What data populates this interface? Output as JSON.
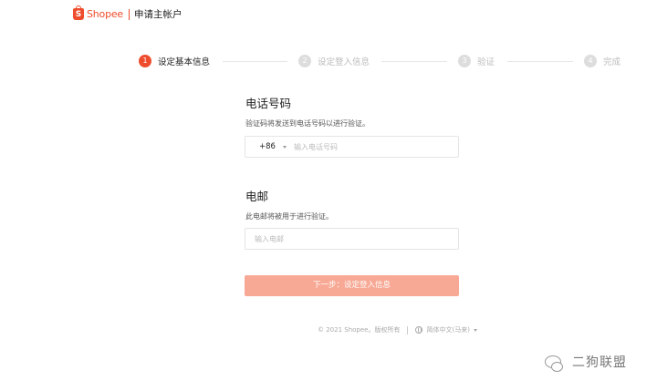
{
  "header": {
    "brand": "Shopee",
    "title": "申请主帐户"
  },
  "stepper": {
    "steps": [
      {
        "num": "1",
        "label": "设定基本信息"
      },
      {
        "num": "2",
        "label": "设定登入信息"
      },
      {
        "num": "3",
        "label": "验证"
      },
      {
        "num": "4",
        "label": "完成"
      }
    ]
  },
  "phone": {
    "title": "电话号码",
    "desc": "验证码将发送到电话号码以进行验证。",
    "country_code": "+86",
    "placeholder": "输入电话号码"
  },
  "email": {
    "title": "电邮",
    "desc": "此电邮将被用于进行验证。",
    "placeholder": "输入电邮"
  },
  "submit_label": "下一步：设定登入信息",
  "footer": {
    "copyright": "© 2021 Shopee。版权所有",
    "language": "简体中文(马来)"
  },
  "watermark": "二狗联盟",
  "colors": {
    "brand": "#ee4d2d",
    "button_disabled": "#f7a995"
  }
}
